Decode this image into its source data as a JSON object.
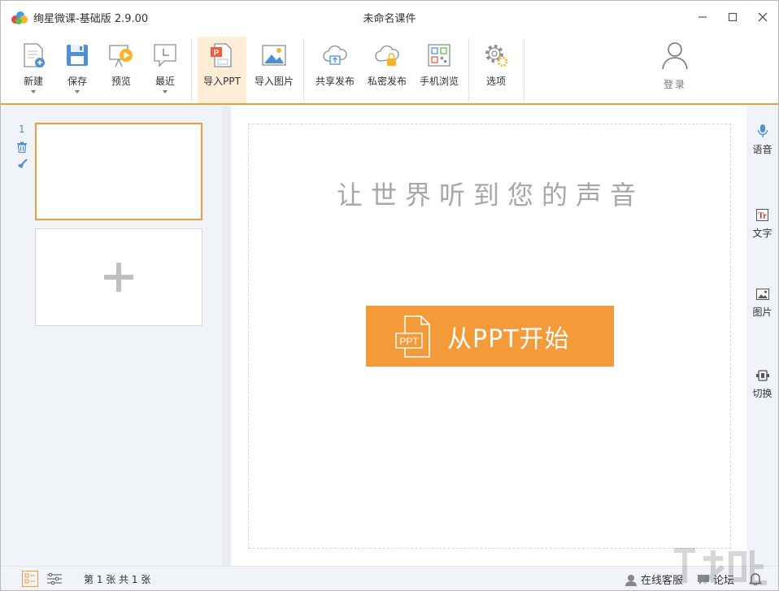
{
  "window": {
    "app_title": "绚星微课-基础版 2.9.00",
    "doc_title": "未命名课件"
  },
  "toolbar": {
    "new_label": "新建",
    "save_label": "保存",
    "preview_label": "预览",
    "recent_label": "最近",
    "import_ppt_label": "导入PPT",
    "import_image_label": "导入图片",
    "share_publish_label": "共享发布",
    "private_publish_label": "私密发布",
    "mobile_view_label": "手机浏览",
    "options_label": "选项",
    "login_label": "登录"
  },
  "slides": {
    "current_number": "1"
  },
  "canvas": {
    "slogan": "让世界听到您的声音",
    "start_button_label": "从PPT开始",
    "ppt_icon_text": "PPT"
  },
  "side_tools": {
    "voice_label": "语音",
    "text_label": "文字",
    "image_label": "图片",
    "switch_label": "切换"
  },
  "statusbar": {
    "page_info": "第 1 张  共 1 张",
    "service_label": "在线客服",
    "forum_label": "论坛"
  },
  "colors": {
    "accent": "#f59a38",
    "accent_light": "#fdecd6",
    "slide_index": "#4f8fd6",
    "panel_bg": "#f0f3f7"
  }
}
